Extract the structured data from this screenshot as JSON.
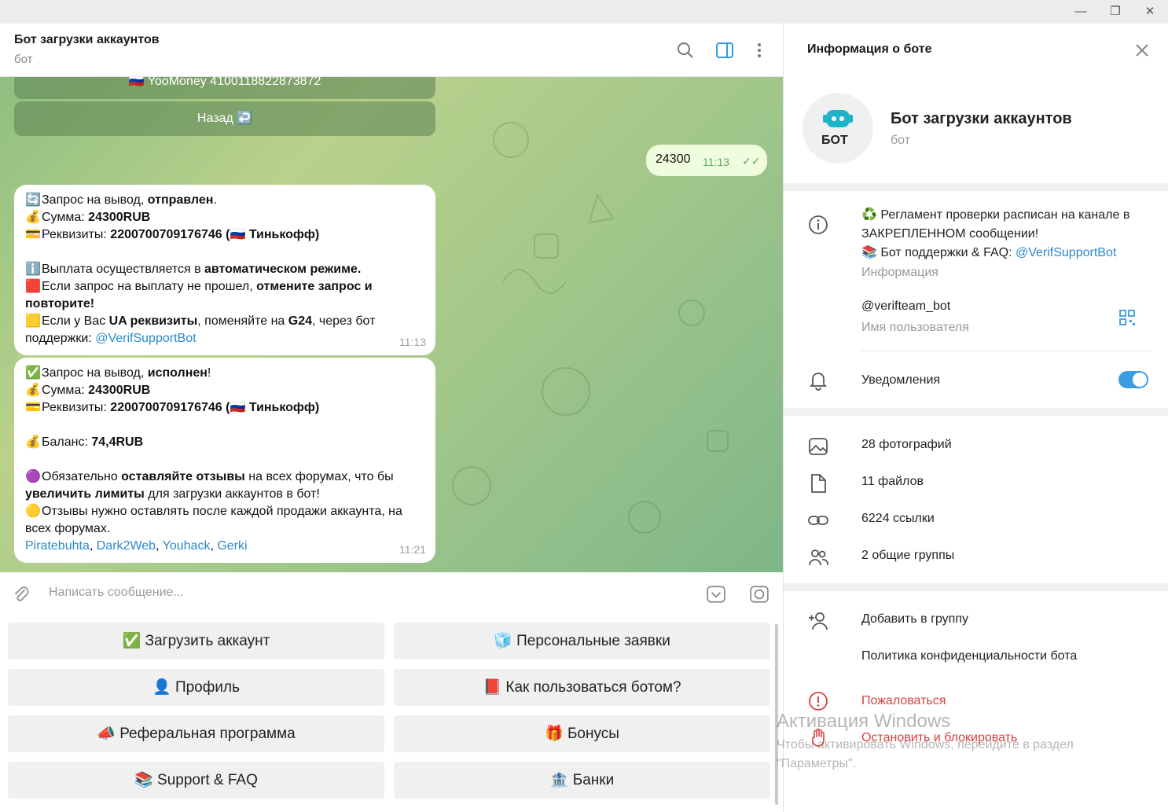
{
  "window": {
    "minimize": "—",
    "maximize": "❐",
    "close": "✕"
  },
  "chat": {
    "title": "Бот загрузки аккаунтов",
    "subtitle": "бот",
    "old_keyboard": {
      "yoomoney": "🇷🇺 YooMoney 4100118822873872",
      "back": "Назад ↩️"
    },
    "outgoing": {
      "text": "24300",
      "time": "11:13",
      "check": "✓✓"
    },
    "msg1": {
      "l1_emoji": "🔄",
      "l1a": "Запрос на вывод, ",
      "l1b": "отправлен",
      "l1c": ".",
      "l2_emoji": "💰",
      "l2a": "Сумма: ",
      "l2b": "24300RUB",
      "l3_emoji": "💳",
      "l3a": "Реквизиты: ",
      "l3b": "2200700709176746 (🇷🇺 Тинькофф)",
      "l4_emoji": "ℹ️",
      "l4a": "Выплата осуществляется в ",
      "l4b": "автоматическом режиме.",
      "l5_emoji": "🟥",
      "l5a": "Если запрос на выплату не прошел, ",
      "l5b": "отмените запрос и повторите!",
      "l6_emoji": "🟨",
      "l6a": "Если у Вас ",
      "l6b": "UA реквизиты",
      "l6c": ", поменяйте на ",
      "l6d": "G24",
      "l6e": ", через бот поддержки: ",
      "l6link": "@VerifSupportBot",
      "time": "11:13"
    },
    "msg2": {
      "l1_emoji": "✅",
      "l1a": "Запрос на вывод, ",
      "l1b": "исполнен",
      "l1c": "!",
      "l2_emoji": "💰",
      "l2a": "Сумма: ",
      "l2b": "24300RUB",
      "l3_emoji": "💳",
      "l3a": "Реквизиты: ",
      "l3b": "2200700709176746 (🇷🇺 Тинькофф)",
      "l4_emoji": "💰",
      "l4a": "Баланс: ",
      "l4b": "74,4RUB",
      "l5_emoji": "🟣",
      "l5a": "Обязательно ",
      "l5b": "оставляйте отзывы",
      "l5c": " на всех форумах, что бы ",
      "l5d": "увеличить лимиты",
      "l5e": " для загрузки аккаунтов в бот!",
      "l6_emoji": "🟡",
      "l6a": "Отзывы нужно оставлять после каждой продажи аккаунта, на всех форумах.",
      "links": [
        "Piratebuhta",
        "Dark2Web",
        "Youhack",
        "Gerki"
      ],
      "time": "11:21"
    },
    "input_placeholder": "Написать сообщение..."
  },
  "keyboard": {
    "upload": "✅ Загрузить аккаунт",
    "personal": "🧊 Персональные заявки",
    "profile": "👤 Профиль",
    "howto": "📕 Как пользоваться ботом?",
    "referral": "📣 Реферальная программа",
    "bonuses": "🎁 Бонусы",
    "support": "📚 Support & FAQ",
    "banks": "🏦 Банки"
  },
  "panel": {
    "title": "Информация о боте",
    "avatar_text": "БОТ",
    "name": "Бот загрузки аккаунтов",
    "sub": "бот",
    "info_line1": "♻️ Регламент проверки расписан на канале в ЗАКРЕПЛЕННОМ сообщении!",
    "info_line2a": "📚 Бот поддержки & FAQ: ",
    "info_line2link": "@VerifSupportBot",
    "info_label": "Информация",
    "username": "@verifteam_bot",
    "username_label": "Имя пользователя",
    "notifications": "Уведомления",
    "notifications_on": true,
    "photos": "28 фотографий",
    "files": "11 файлов",
    "links": "6224 ссылки",
    "groups": "2 общие группы",
    "add_group": "Добавить в группу",
    "privacy": "Политика конфиденциальности бота",
    "report": "Пожаловаться",
    "block": "Остановить и блокировать"
  },
  "watermark": {
    "line1": "Активация Windows",
    "line2": "Чтобы активировать Windows, перейдите в раздел \"Параметры\"."
  }
}
